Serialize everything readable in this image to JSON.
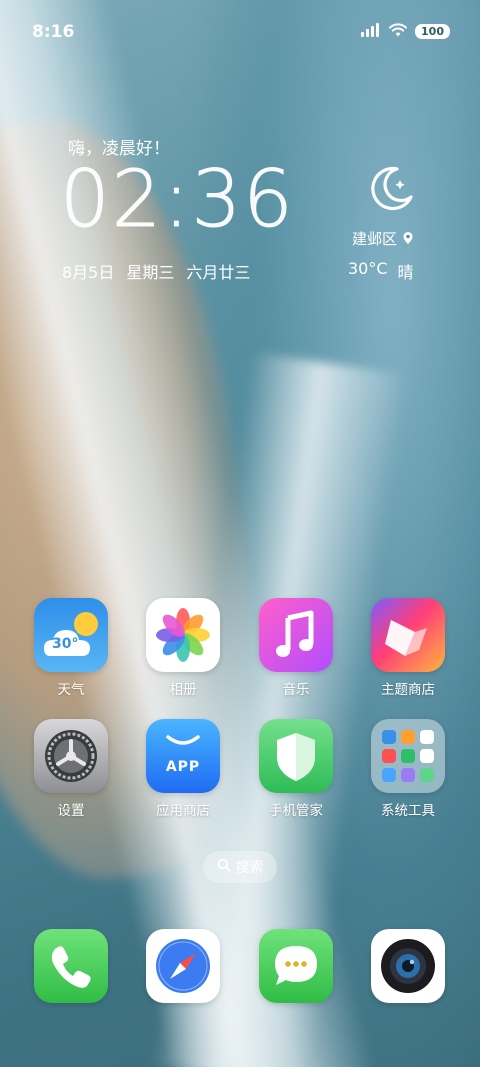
{
  "status_bar": {
    "time": "8:16",
    "battery": "100",
    "icons": [
      "signal-icon",
      "wifi-icon",
      "battery-icon"
    ]
  },
  "clock_widget": {
    "greeting": "嗨，凌晨好！",
    "time": "02:36",
    "date": "8月5日",
    "weekday": "星期三",
    "lunar_date": "六月廿三",
    "location": "建邺区",
    "temperature": "30°C",
    "condition": "晴",
    "icons": [
      "moon-icon",
      "location-pin-icon"
    ]
  },
  "apps": [
    {
      "label": "天气",
      "icon": "weather-icon",
      "badge_text": "30°"
    },
    {
      "label": "相册",
      "icon": "photos-icon"
    },
    {
      "label": "音乐",
      "icon": "music-icon"
    },
    {
      "label": "主题商店",
      "icon": "theme-store-icon"
    },
    {
      "label": "设置",
      "icon": "settings-icon"
    },
    {
      "label": "应用商店",
      "icon": "app-store-icon",
      "badge_text": "APP"
    },
    {
      "label": "手机管家",
      "icon": "phone-manager-icon"
    },
    {
      "label": "系统工具",
      "icon": "folder-icon"
    }
  ],
  "search": {
    "label": "搜索",
    "icon": "search-icon"
  },
  "dock": [
    {
      "icon": "phone-icon"
    },
    {
      "icon": "browser-icon"
    },
    {
      "icon": "messages-icon"
    },
    {
      "icon": "camera-icon"
    }
  ],
  "colors": {
    "weather_bg": "#2f8ee8",
    "music_bg": "#c254ff",
    "appstore_bg": "#1f6cf2",
    "green_app": "#2fbd46"
  }
}
